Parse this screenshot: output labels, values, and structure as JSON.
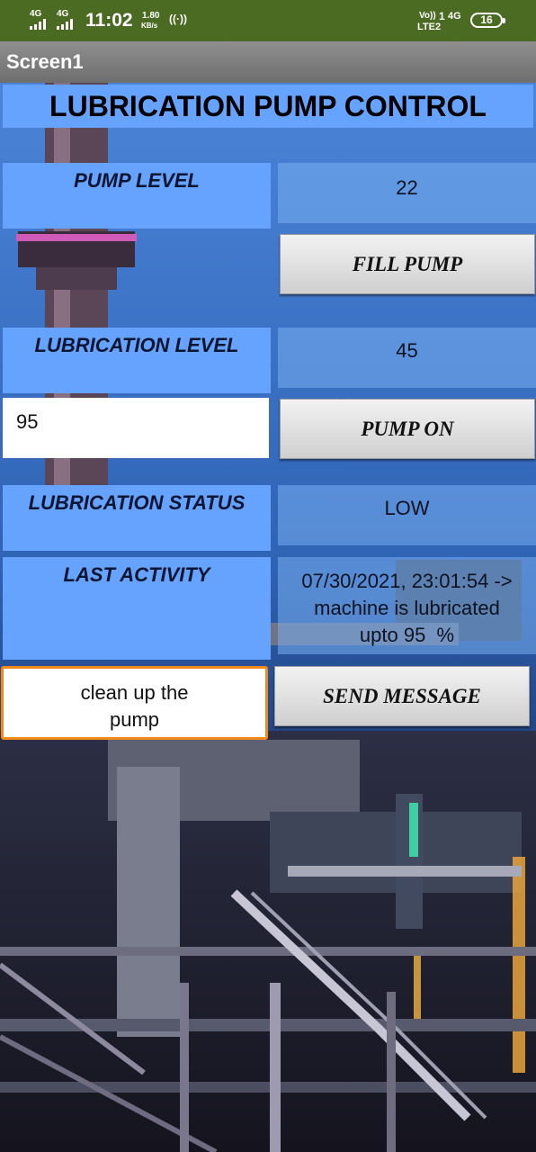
{
  "status_bar": {
    "network_left_1": "4G",
    "network_left_2": "4G",
    "time": "11:02",
    "speed_value": "1.80",
    "speed_unit": "KB/s",
    "volte_label": "Vo))",
    "lte_label": "LTE2",
    "sim_number": "1",
    "network_right": "4G",
    "battery": "16"
  },
  "titlebar": {
    "title": "Screen1"
  },
  "header": {
    "title": "LUBRICATION PUMP CONTROL"
  },
  "pump_level": {
    "label": "PUMP LEVEL",
    "value": "22"
  },
  "fill_pump_button": "FILL PUMP",
  "lubrication_level": {
    "label": "LUBRICATION LEVEL",
    "value": "45"
  },
  "lubrication_input": {
    "value": "95"
  },
  "pump_on_button": "PUMP ON",
  "lubrication_status": {
    "label": "LUBRICATION STATUS",
    "value": "LOW"
  },
  "last_activity": {
    "label": "LAST ACTIVITY",
    "line1": "07/30/2021, 23:01:54 ->",
    "line2": "machine is lubricated",
    "line3": "upto 95  %"
  },
  "message_input": {
    "line1": "clean up the",
    "line2": "pump"
  },
  "send_message_button": "SEND MESSAGE",
  "colors": {
    "status_bar": "#4b6b23",
    "label_bg": "#65a3ff",
    "input_focus_border": "#f08a1c"
  }
}
